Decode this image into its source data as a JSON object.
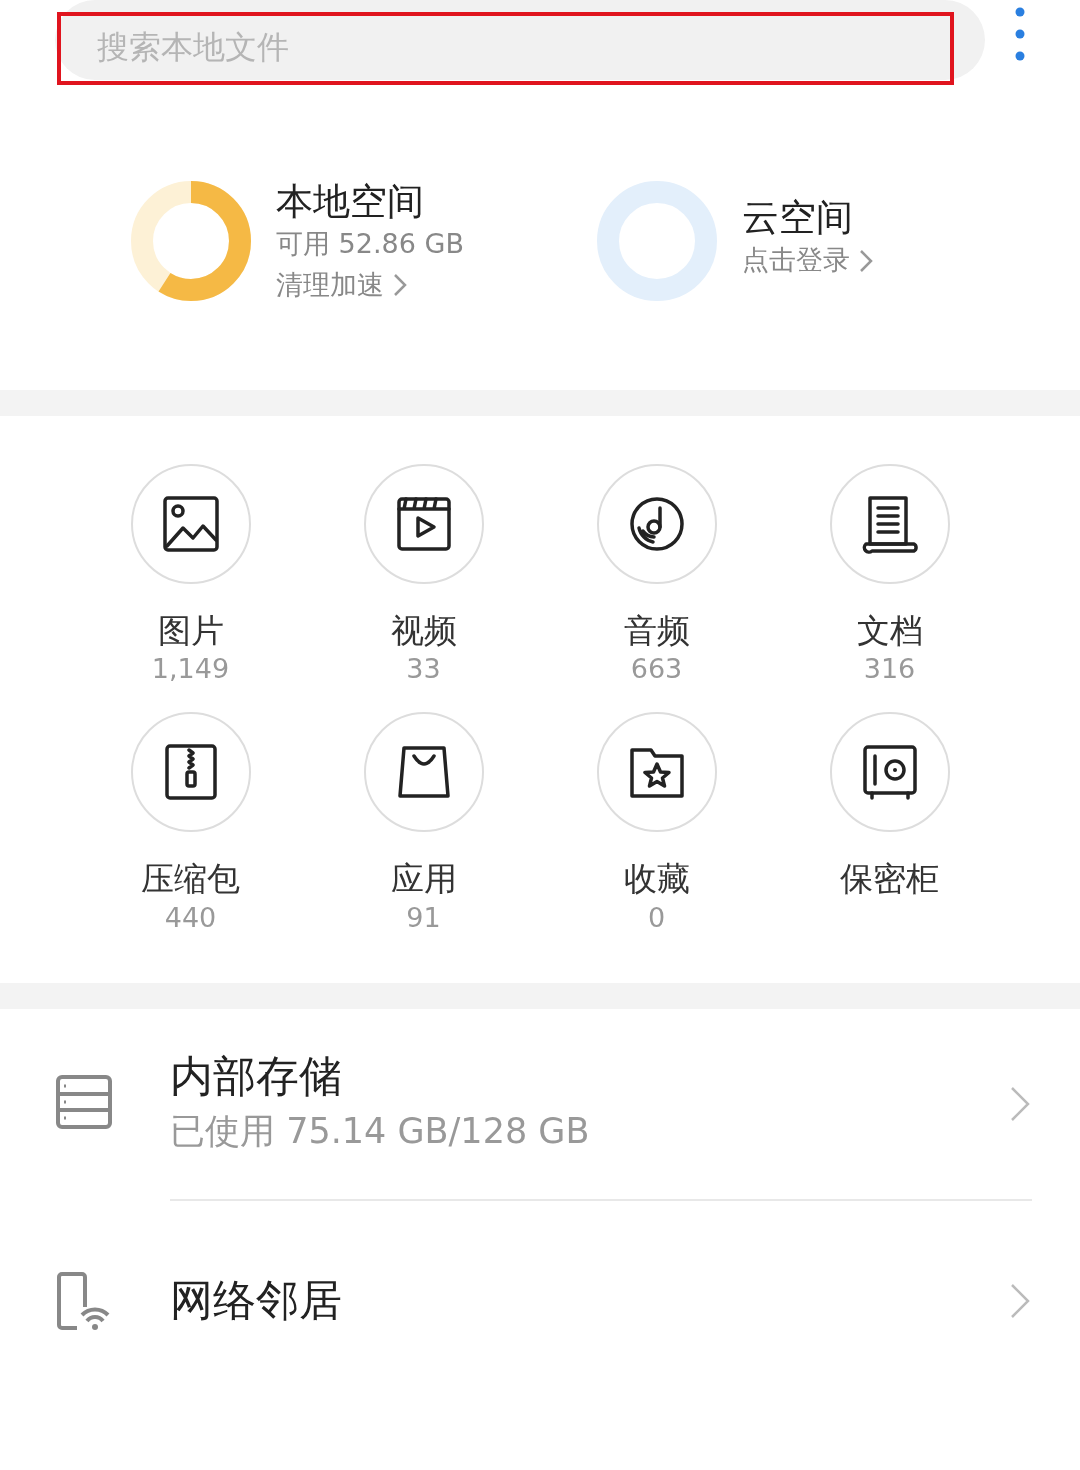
{
  "search": {
    "placeholder": "搜索本地文件",
    "highlighted": true
  },
  "spaces": [
    {
      "kind": "local",
      "title": "本地空间",
      "detail": "可用 52.86 GB",
      "action": "清理加速",
      "level": 0.59,
      "color": "#f5b945"
    },
    {
      "kind": "cloud",
      "title": "云空间",
      "action": "点击登录",
      "color": "#e3effb"
    }
  ],
  "categories": [
    {
      "kind": "image",
      "label": "图片",
      "count": "1,149"
    },
    {
      "kind": "video",
      "label": "视频",
      "count": "33"
    },
    {
      "kind": "audio",
      "label": "音频",
      "count": "663"
    },
    {
      "kind": "document",
      "label": "文档",
      "count": "316"
    },
    {
      "kind": "archive",
      "label": "压缩包",
      "count": "440"
    },
    {
      "kind": "app",
      "label": "应用",
      "count": "91"
    },
    {
      "kind": "favorite",
      "label": "收藏",
      "count": "0"
    },
    {
      "kind": "safe",
      "label": "保密柜"
    }
  ],
  "locations": [
    {
      "kind": "storage",
      "title": "内部存储",
      "detail": "已使用 75.14 GB/128 GB"
    },
    {
      "kind": "network",
      "title": "网络邻居"
    }
  ]
}
